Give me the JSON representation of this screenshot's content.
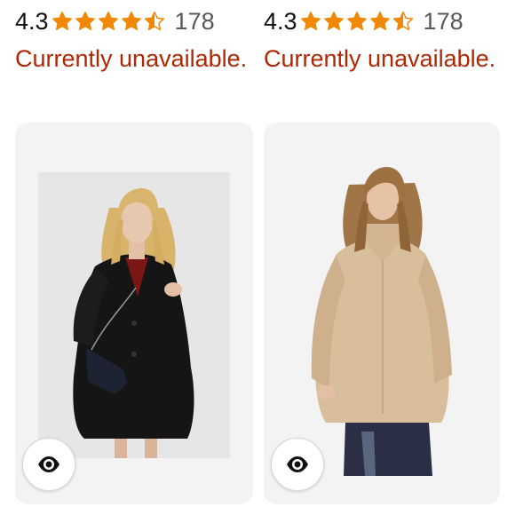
{
  "products": [
    {
      "clipped_title": "",
      "rating_value": "4.3",
      "rating_stars": 4.5,
      "rating_count": "178",
      "availability": "Currently unavailable.",
      "quick_view_icon": "eye-icon",
      "star_color": "#F08804",
      "availability_color": "#B12704"
    },
    {
      "clipped_title": "",
      "rating_value": "4.3",
      "rating_stars": 4.5,
      "rating_count": "178",
      "availability": "Currently unavailable.",
      "quick_view_icon": "eye-icon",
      "star_color": "#F08804",
      "availability_color": "#B12704"
    }
  ]
}
